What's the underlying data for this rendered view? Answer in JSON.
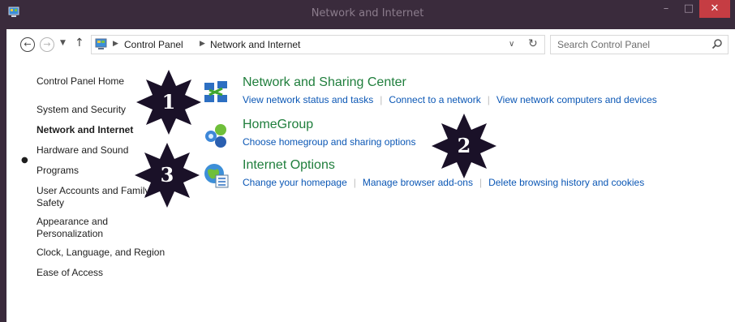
{
  "window": {
    "title": "Network and Internet",
    "minimize_label": "–",
    "maximize_label": "□",
    "close_label": "✕"
  },
  "address": {
    "crumbs": [
      "Control Panel",
      "Network and Internet"
    ],
    "search_placeholder": "Search Control Panel"
  },
  "sidebar": {
    "items": [
      {
        "label": "Control Panel Home"
      },
      {
        "label": "System and Security"
      },
      {
        "label": "Network and Internet"
      },
      {
        "label": "Hardware and Sound"
      },
      {
        "label": "Programs"
      },
      {
        "label": "User Accounts and Family Safety"
      },
      {
        "label": "Appearance and Personalization"
      },
      {
        "label": "Clock, Language, and Region"
      },
      {
        "label": "Ease of Access"
      }
    ]
  },
  "categories": [
    {
      "title": "Network and Sharing Center",
      "icon": "network-sharing-icon",
      "links": [
        "View network status and tasks",
        "Connect to a network",
        "View network computers and devices"
      ]
    },
    {
      "title": "HomeGroup",
      "icon": "homegroup-icon",
      "links": [
        "Choose homegroup and sharing options"
      ]
    },
    {
      "title": "Internet Options",
      "icon": "internet-options-icon",
      "links": [
        "Change your homepage",
        "Manage browser add-ons",
        "Delete browsing history and cookies"
      ]
    }
  ],
  "callouts": [
    "1",
    "2",
    "3"
  ],
  "colors": {
    "title_bar": "#3a2b3c",
    "close_button": "#c53d43",
    "category_title": "#1f7e3c",
    "link": "#0b57b5",
    "callout_star": "#1a1128"
  }
}
